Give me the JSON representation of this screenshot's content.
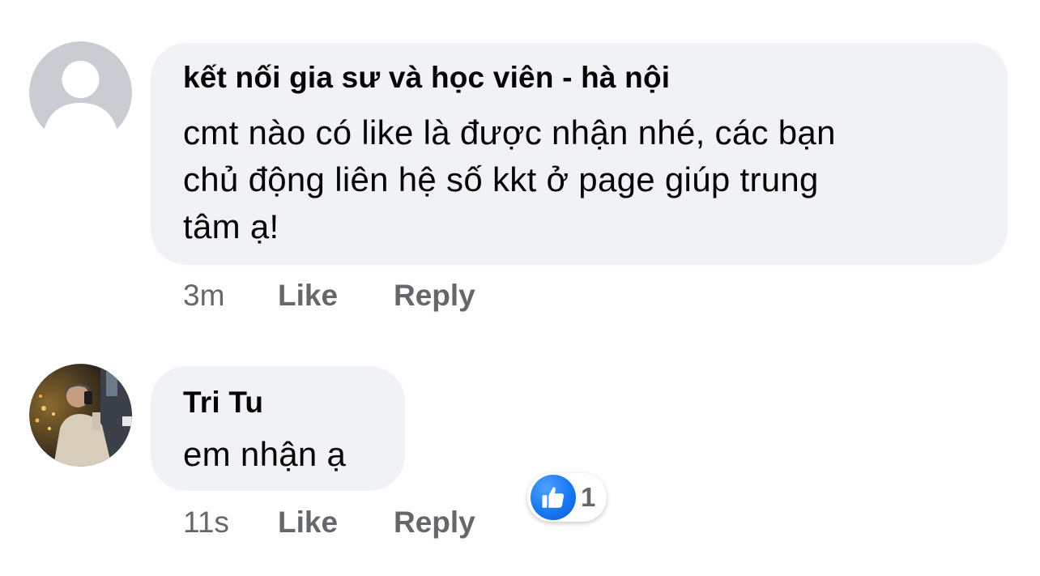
{
  "comments": [
    {
      "avatar": {
        "type": "default-profile-icon",
        "bg_color": "#c9ccd1",
        "fg_color": "#ffffff"
      },
      "author": "kết nối gia sư và học viên - hà nội",
      "lines": [
        "cmt nào có like là được nhận nhé, các bạn",
        "chủ động liên hệ số kkt ở page giúp trung",
        "tâm ạ!"
      ],
      "time": "3m",
      "like_label": "Like",
      "reply_label": "Reply"
    },
    {
      "avatar": {
        "type": "user-photo"
      },
      "author": "Tri Tu",
      "lines": [
        "em nhận ạ"
      ],
      "time": "11s",
      "like_label": "Like",
      "reply_label": "Reply",
      "reaction": {
        "icon": "thumbs-up-icon",
        "count": "1",
        "color": "#1877f2"
      }
    }
  ],
  "colors": {
    "bubble_bg": "#f0f2f5",
    "meta_text": "#65676b",
    "body_text": "#050505",
    "like_blue": "#1877f2"
  }
}
